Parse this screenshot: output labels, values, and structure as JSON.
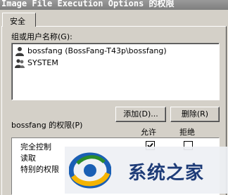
{
  "window": {
    "title": "Image File Execution Options 的权限"
  },
  "tabs": [
    {
      "label": "安全"
    }
  ],
  "groups_label": "组或用户名称(G):",
  "users": [
    {
      "label": "bossfang (BossFang-T43p\\bossfang)"
    },
    {
      "label": "SYSTEM"
    }
  ],
  "buttons": {
    "add": "添加(D)...",
    "remove": "删除(R)"
  },
  "permissions": {
    "header": "bossfang 的权限(P)",
    "allow": "允许",
    "deny": "拒绝",
    "rows": [
      {
        "label": "完全控制",
        "allow": true,
        "deny": false
      },
      {
        "label": "读取"
      },
      {
        "label": "特别的权限"
      }
    ]
  },
  "watermark": {
    "text": "系统之家"
  }
}
